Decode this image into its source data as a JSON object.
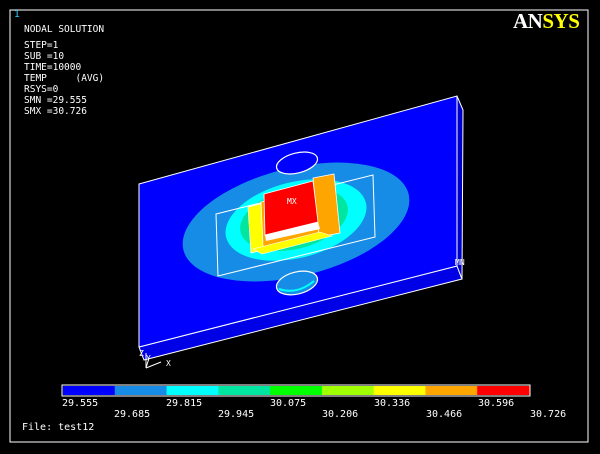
{
  "window_number": "1",
  "title": "NODAL SOLUTION",
  "params": [
    "STEP=1",
    "SUB =10",
    "TIME=10000",
    "TEMP     (AVG)",
    "RSYS=0",
    "SMN =29.555",
    "SMX =30.726"
  ],
  "logo": {
    "first": "AN",
    "second": "SYS"
  },
  "markers": {
    "max": "MX",
    "min": "MN"
  },
  "axes": {
    "z": "Z",
    "y": "Y",
    "x": "X"
  },
  "legend": {
    "colors": [
      "#0000ff",
      "#178ce6",
      "#00ffff",
      "#00e6a0",
      "#00ff00",
      "#a0ff00",
      "#ffff00",
      "#ffa500",
      "#ff0000"
    ],
    "labels_top": [
      "29.555",
      "29.815",
      "30.075",
      "30.336",
      "30.596"
    ],
    "labels_bottom": [
      "29.685",
      "29.945",
      "30.206",
      "30.466",
      "30.726"
    ]
  },
  "file": "File: test12"
}
